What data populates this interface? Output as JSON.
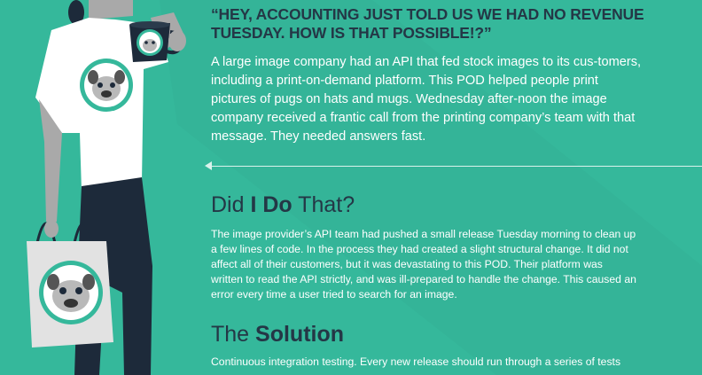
{
  "colors": {
    "background": "#35b89b",
    "heading": "#243746",
    "body_text": "#ffffff",
    "shirt": "#ffffff",
    "skin": "#a9a9a9",
    "pants": "#1d2a3a",
    "mug": "#1d2a3a",
    "pug_badge": "#35b89b"
  },
  "quote": "“HEY, ACCOUNTING JUST TOLD US WE HAD NO REVENUE TUESDAY. HOW IS THAT POSSIBLE!?”",
  "intro": "A large image company had an API that fed stock images to its cus-tomers, including a print-on-demand platform. This POD helped people print pictures of pugs on hats and mugs. Wednesday after-noon the image company received a frantic call from the printing company’s team with that message. They needed answers fast.",
  "section1": {
    "title_pre": "Did ",
    "title_bold": "I Do",
    "title_post": " That?",
    "body": "The image provider’s API team had pushed a small release Tuesday morning to clean up a few lines of code. In the process they had created a slight structural change. It did not affect all of their customers, but it was devastating to this POD. Their platform was written to read the API strictly, and was ill-prepared to handle the change. This caused an error every time a user tried to search for an image."
  },
  "section2": {
    "title_pre": "The ",
    "title_bold": "Solution",
    "body": "Continuous integration testing. Every new release should run through a series of tests"
  },
  "icons": [
    "pug-mug-icon",
    "pug-shirt-icon",
    "pug-tote-icon",
    "arrow-left-icon"
  ]
}
